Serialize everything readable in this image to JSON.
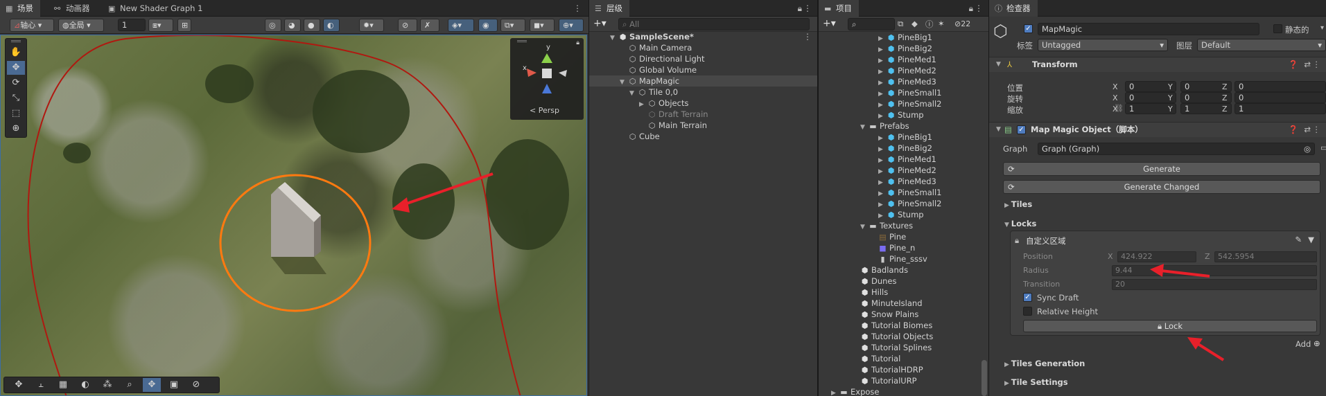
{
  "scene_panel": {
    "tabs": [
      {
        "label": "场景",
        "icon": "grid-icon"
      },
      {
        "label": "动画器",
        "icon": "animator-icon"
      },
      {
        "label": "New Shader Graph 1",
        "icon": "shader-graph-icon"
      }
    ],
    "toolbar": {
      "pivot_label": "轴心",
      "global_label": "全局",
      "grid_value": "1"
    },
    "gizmo": {
      "y_label": "y",
      "x_label": "x",
      "persp_label": "< Persp"
    }
  },
  "hierarchy": {
    "tab": "层级",
    "search_placeholder": "All",
    "items": [
      {
        "label": "SampleScene*",
        "depth": 0,
        "type": "scene"
      },
      {
        "label": "Main Camera",
        "depth": 1,
        "type": "object"
      },
      {
        "label": "Directional Light",
        "depth": 1,
        "type": "object"
      },
      {
        "label": "Global Volume",
        "depth": 1,
        "type": "object"
      },
      {
        "label": "MapMagic",
        "depth": 1,
        "type": "object"
      },
      {
        "label": "Tile 0,0",
        "depth": 2,
        "type": "object"
      },
      {
        "label": "Objects",
        "depth": 3,
        "type": "object"
      },
      {
        "label": "Draft Terrain",
        "depth": 3,
        "type": "object-dim"
      },
      {
        "label": "Main Terrain",
        "depth": 3,
        "type": "object"
      },
      {
        "label": "Cube",
        "depth": 1,
        "type": "object"
      }
    ]
  },
  "project": {
    "tab": "项目",
    "badge_count": "22",
    "items": [
      {
        "label": "PineBig1",
        "depth": 2,
        "type": "prefab"
      },
      {
        "label": "PineBig2",
        "depth": 2,
        "type": "prefab"
      },
      {
        "label": "PineMed1",
        "depth": 2,
        "type": "prefab"
      },
      {
        "label": "PineMed2",
        "depth": 2,
        "type": "prefab"
      },
      {
        "label": "PineMed3",
        "depth": 2,
        "type": "prefab"
      },
      {
        "label": "PineSmall1",
        "depth": 2,
        "type": "prefab"
      },
      {
        "label": "PineSmall2",
        "depth": 2,
        "type": "prefab"
      },
      {
        "label": "Stump",
        "depth": 2,
        "type": "prefab"
      },
      {
        "label": "Prefabs",
        "depth": 1,
        "type": "folder"
      },
      {
        "label": "PineBig1",
        "depth": 2,
        "type": "prefab"
      },
      {
        "label": "PineBig2",
        "depth": 2,
        "type": "prefab"
      },
      {
        "label": "PineMed1",
        "depth": 2,
        "type": "prefab"
      },
      {
        "label": "PineMed2",
        "depth": 2,
        "type": "prefab"
      },
      {
        "label": "PineMed3",
        "depth": 2,
        "type": "prefab"
      },
      {
        "label": "PineSmall1",
        "depth": 2,
        "type": "prefab"
      },
      {
        "label": "PineSmall2",
        "depth": 2,
        "type": "prefab"
      },
      {
        "label": "Stump",
        "depth": 2,
        "type": "prefab"
      },
      {
        "label": "Textures",
        "depth": 1,
        "type": "folder"
      },
      {
        "label": "Pine",
        "depth": 2,
        "type": "texture"
      },
      {
        "label": "Pine_n",
        "depth": 2,
        "type": "texture-normal"
      },
      {
        "label": "Pine_sssv",
        "depth": 2,
        "type": "texture-white"
      },
      {
        "label": "Badlands",
        "depth": 0,
        "type": "scene"
      },
      {
        "label": "Dunes",
        "depth": 0,
        "type": "scene"
      },
      {
        "label": "Hills",
        "depth": 0,
        "type": "scene"
      },
      {
        "label": "MinuteIsland",
        "depth": 0,
        "type": "scene"
      },
      {
        "label": "Snow Plains",
        "depth": 0,
        "type": "scene"
      },
      {
        "label": "Tutorial Biomes",
        "depth": 0,
        "type": "scene"
      },
      {
        "label": "Tutorial Objects",
        "depth": 0,
        "type": "scene"
      },
      {
        "label": "Tutorial Splines",
        "depth": 0,
        "type": "scene"
      },
      {
        "label": "Tutorial",
        "depth": 0,
        "type": "scene"
      },
      {
        "label": "TutorialHDRP",
        "depth": 0,
        "type": "scene"
      },
      {
        "label": "TutorialURP",
        "depth": 0,
        "type": "scene"
      },
      {
        "label": "Expose",
        "depth": -1,
        "type": "folder"
      }
    ]
  },
  "inspector": {
    "tab": "检查器",
    "object_name": "MapMagic",
    "static_label": "静态的",
    "tag_label": "标签",
    "tag_value": "Untagged",
    "layer_label": "图层",
    "layer_value": "Default",
    "transform": {
      "title": "Transform",
      "position_label": "位置",
      "rotation_label": "旋转",
      "scale_label": "缩放",
      "position": [
        "0",
        "0",
        "0"
      ],
      "rotation": [
        "0",
        "0",
        "0"
      ],
      "scale": [
        "1",
        "1",
        "1"
      ],
      "axes": [
        "X",
        "Y",
        "Z"
      ]
    },
    "component": {
      "title": "Map Magic Object（脚本）",
      "graph_label": "Graph",
      "graph_value": "Graph (Graph)",
      "generate_label": "Generate",
      "generate_changed_label": "Generate Changed",
      "tiles_label": "Tiles",
      "locks_label": "Locks",
      "lock_item": {
        "name": "自定义区域",
        "position_label": "Position",
        "position_x_label": "X",
        "position_x": "424.922",
        "position_z_label": "Z",
        "position_z": "542.5954",
        "radius_label": "Radius",
        "radius_value": "9.44",
        "transition_label": "Transition",
        "transition_value": "20",
        "sync_draft_label": "Sync Draft",
        "sync_draft": true,
        "relative_height_label": "Relative Height",
        "relative_height": false,
        "lock_button": "Lock"
      },
      "add_label": "Add",
      "tiles_generation_label": "Tiles Generation",
      "tile_settings_label": "Tile Settings"
    }
  },
  "colors": {
    "accent_blue": "#4a6a93",
    "annotation_red": "#e8202a",
    "lock_circle_orange": "#ff7a10",
    "terrain_border_red": "#b01810",
    "prefab_blue": "#4fc1f0"
  }
}
